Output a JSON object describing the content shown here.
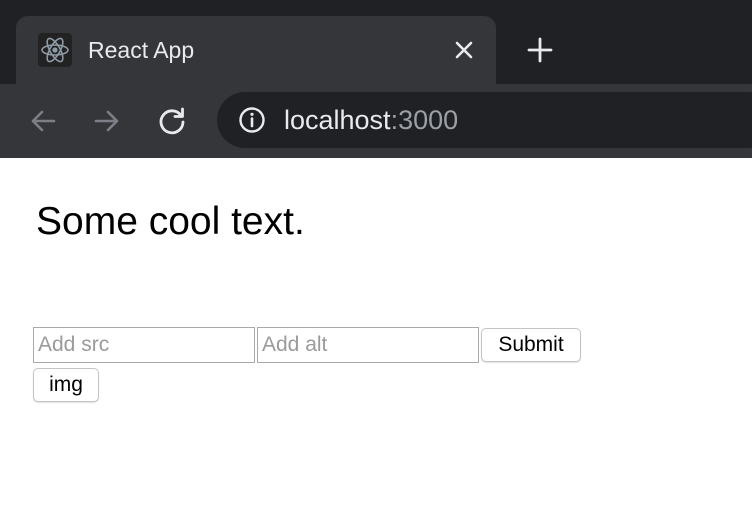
{
  "browser": {
    "tab": {
      "title": "React App",
      "favicon": "react-logo-icon",
      "close_icon": "close-icon"
    },
    "new_tab_icon": "plus-icon",
    "nav": {
      "back_icon": "arrow-left-icon",
      "forward_icon": "arrow-right-icon",
      "reload_icon": "reload-icon"
    },
    "address": {
      "info_icon": "info-icon",
      "host": "localhost",
      "port": ":3000"
    },
    "colors": {
      "tabstrip": "#202124",
      "toolbar": "#35363a",
      "text": "#e8eaed",
      "muted": "#9aa0a6"
    }
  },
  "page": {
    "heading": "Some cool text.",
    "src_input": {
      "placeholder": "Add src",
      "value": ""
    },
    "alt_input": {
      "placeholder": "Add alt",
      "value": ""
    },
    "submit_label": "Submit",
    "img_label": "img"
  }
}
